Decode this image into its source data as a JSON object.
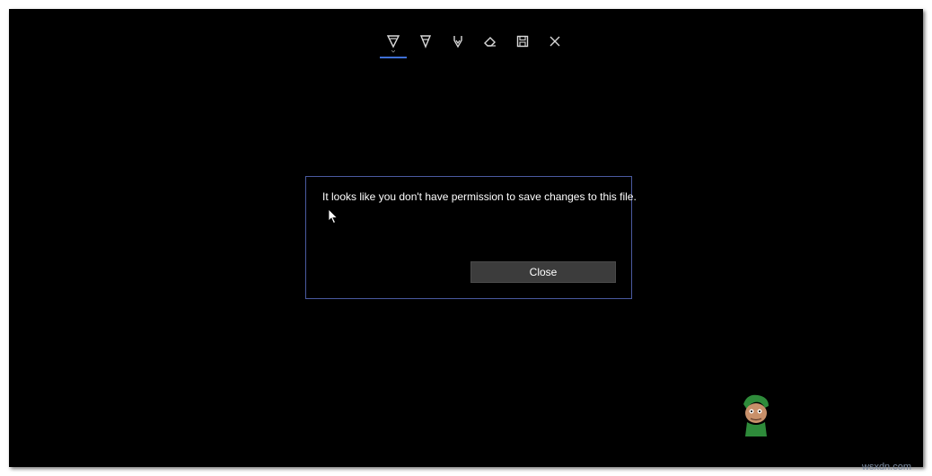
{
  "toolbar": {
    "tools": [
      {
        "icon": "ballpoint-pen-icon",
        "active": true
      },
      {
        "icon": "pencil-icon",
        "active": false
      },
      {
        "icon": "highlighter-icon",
        "active": false
      },
      {
        "icon": "eraser-icon",
        "active": false
      },
      {
        "icon": "save-icon",
        "active": false
      },
      {
        "icon": "close-icon",
        "active": false
      }
    ],
    "accent_color": "#3f6fd6"
  },
  "dialog": {
    "message": "It looks like you don't have permission to save changes to this file.",
    "close_label": "Close",
    "border_color": "#4a5aa0"
  },
  "watermark": {
    "text": "wsxdn.com",
    "logo_icon": "appuals-mascot-logo"
  }
}
